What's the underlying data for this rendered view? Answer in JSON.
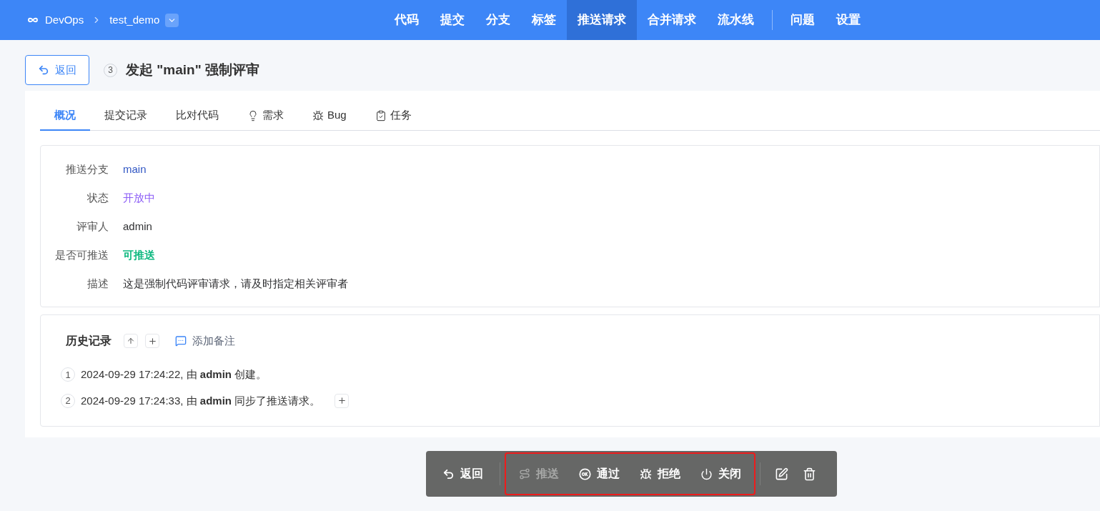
{
  "header": {
    "brand": "DevOps",
    "project": "test_demo",
    "nav_main": [
      {
        "label": "代码",
        "selected": false
      },
      {
        "label": "提交",
        "selected": false
      },
      {
        "label": "分支",
        "selected": false
      },
      {
        "label": "标签",
        "selected": false
      },
      {
        "label": "推送请求",
        "selected": true
      },
      {
        "label": "合并请求",
        "selected": false
      },
      {
        "label": "流水线",
        "selected": false
      }
    ],
    "nav_secondary": [
      {
        "label": "问题",
        "selected": false
      },
      {
        "label": "设置",
        "selected": false
      }
    ]
  },
  "title": {
    "back": "返回",
    "number": "3",
    "text": "发起 \"main\" 强制评审"
  },
  "tabs": [
    {
      "label": "概况",
      "kind": "plain",
      "selected": true
    },
    {
      "label": "提交记录",
      "kind": "plain",
      "selected": false
    },
    {
      "label": "比对代码",
      "kind": "plain",
      "selected": false
    },
    {
      "label": "需求",
      "kind": "idea",
      "selected": false
    },
    {
      "label": "Bug",
      "kind": "bug",
      "selected": false
    },
    {
      "label": "任务",
      "kind": "task",
      "selected": false
    }
  ],
  "fields": [
    {
      "label": "推送分支",
      "value": "main",
      "color": "#3157c4",
      "bold": false
    },
    {
      "label": "状态",
      "value": "开放中",
      "color": "#8b5cf6",
      "bold": false
    },
    {
      "label": "评审人",
      "value": "admin",
      "color": "#303133",
      "bold": false
    },
    {
      "label": "是否可推送",
      "value": "可推送",
      "color": "#10b981",
      "bold": true
    },
    {
      "label": "描述",
      "value": "这是强制代码评审请求，请及时指定相关评审者",
      "color": "#303133",
      "bold": false
    }
  ],
  "history": {
    "title": "历史记录",
    "add_note": "添加备注",
    "entries": [
      {
        "number": "1",
        "text": "2024-09-29 17:24:22, 由 **admin** 创建。",
        "expandable": false
      },
      {
        "number": "2",
        "text": "2024-09-29 17:24:33, 由 **admin** 同步了推送请求。",
        "expandable": true
      }
    ]
  },
  "toolbar": {
    "back": "返回",
    "highlighted": true,
    "actions": [
      {
        "label": "推送",
        "kind": "push",
        "disabled": true
      },
      {
        "label": "通过",
        "kind": "ok",
        "disabled": false
      },
      {
        "label": "拒绝",
        "kind": "bug",
        "disabled": false
      },
      {
        "label": "关闭",
        "kind": "power",
        "disabled": false
      }
    ]
  }
}
